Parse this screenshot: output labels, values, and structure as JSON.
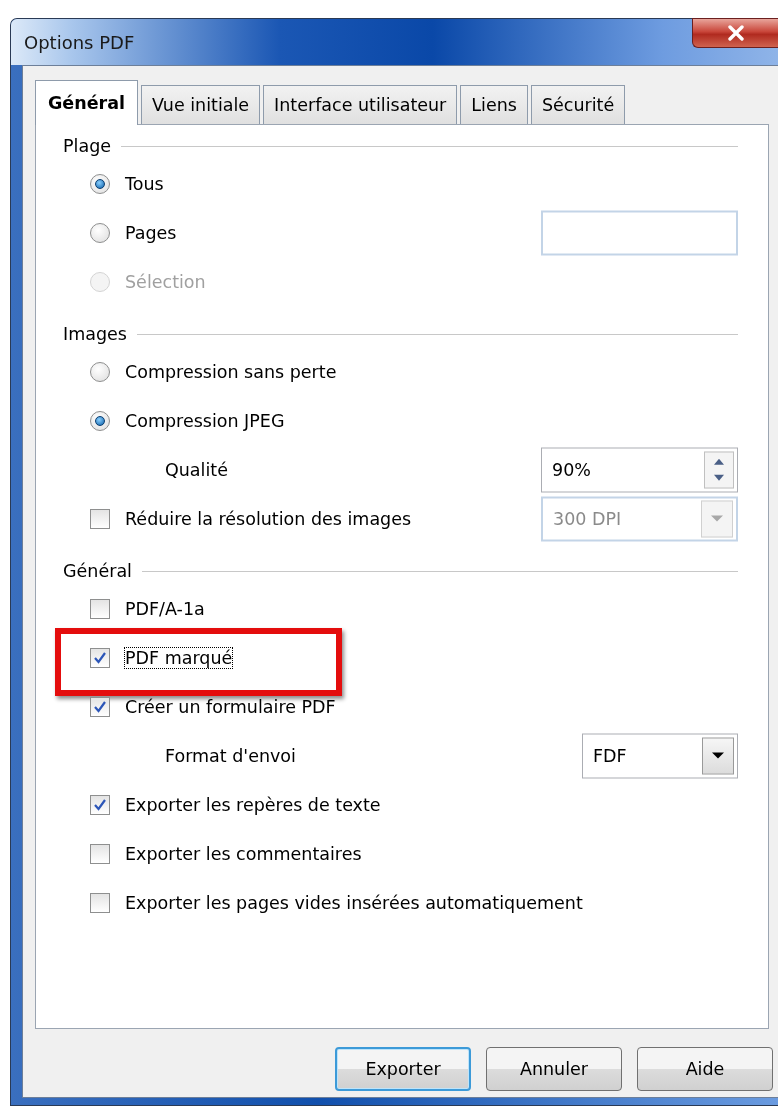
{
  "window": {
    "title": "Options PDF"
  },
  "tabs": [
    {
      "label": "Général",
      "selected": true
    },
    {
      "label": "Vue initiale",
      "selected": false
    },
    {
      "label": "Interface utilisateur",
      "selected": false
    },
    {
      "label": "Liens",
      "selected": false
    },
    {
      "label": "Sécurité",
      "selected": false
    }
  ],
  "sections": [
    {
      "title": "Plage",
      "items": [
        {
          "kind": "radio",
          "label": "Tous",
          "selected": true,
          "disabled": false
        },
        {
          "kind": "radio",
          "label": "Pages",
          "selected": false,
          "disabled": false,
          "field": {
            "kind": "text"
          }
        },
        {
          "kind": "radio",
          "label": "Sélection",
          "selected": false,
          "disabled": true
        }
      ]
    },
    {
      "title": "Images",
      "items": [
        {
          "kind": "radio",
          "label": "Compression sans perte",
          "selected": false,
          "disabled": false
        },
        {
          "kind": "radio",
          "label": "Compression JPEG",
          "selected": true,
          "disabled": false
        },
        {
          "kind": "label",
          "label": "Qualité",
          "field": {
            "kind": "spin",
            "value": "90%"
          }
        },
        {
          "kind": "checkbox",
          "label": "Réduire la résolution des images",
          "checked": false,
          "highlighted": false,
          "focused": false,
          "field": {
            "kind": "combo",
            "value": "300 DPI"
          }
        }
      ]
    },
    {
      "title": "Général",
      "items": [
        {
          "kind": "checkbox",
          "label": "PDF/A-1a",
          "checked": false,
          "highlighted": false,
          "focused": false
        },
        {
          "kind": "checkbox",
          "label": "PDF marqué",
          "checked": true,
          "highlighted": true,
          "focused": true
        },
        {
          "kind": "checkbox",
          "label": "Créer un formulaire PDF",
          "checked": true,
          "highlighted": false,
          "focused": false
        },
        {
          "kind": "label",
          "label": "Format d'envoi",
          "field": {
            "kind": "select",
            "value": "FDF"
          }
        },
        {
          "kind": "checkbox",
          "label": "Exporter les repères de texte",
          "checked": true,
          "highlighted": false,
          "focused": false
        },
        {
          "kind": "checkbox",
          "label": "Exporter les commentaires",
          "checked": false,
          "highlighted": false,
          "focused": false
        },
        {
          "kind": "checkbox",
          "label": "Exporter les pages vides insérées automatiquement",
          "checked": false,
          "highlighted": false,
          "focused": false
        }
      ]
    }
  ],
  "buttons": [
    {
      "label": "Exporter",
      "default": true
    },
    {
      "label": "Annuler",
      "default": false
    },
    {
      "label": "Aide",
      "default": false
    }
  ]
}
